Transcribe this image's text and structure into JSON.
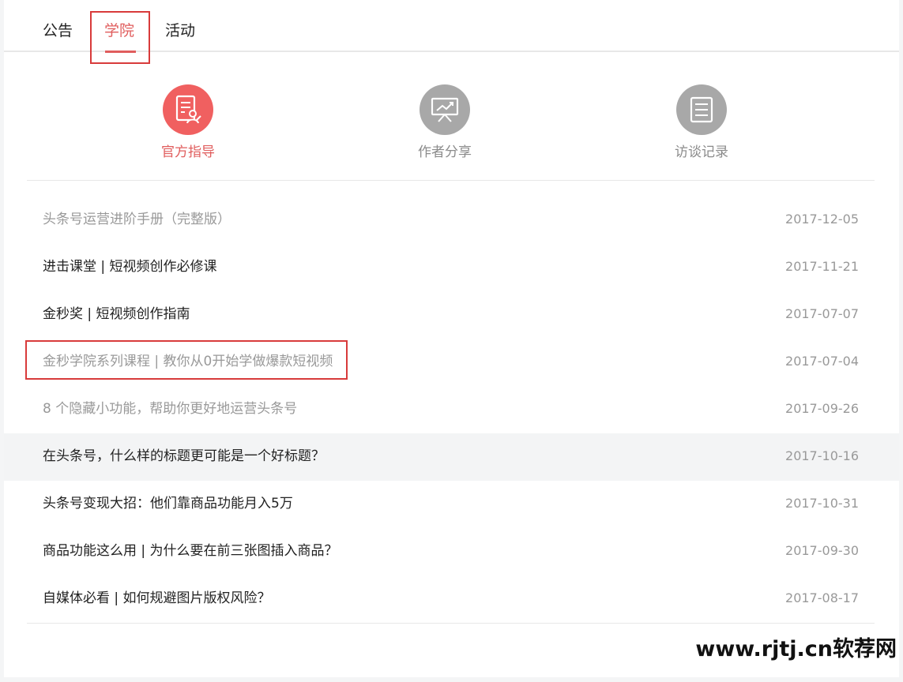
{
  "tabs": [
    {
      "label": "公告"
    },
    {
      "label": "学院"
    },
    {
      "label": "活动"
    }
  ],
  "categories": [
    {
      "label": "官方指导",
      "icon": "official-guide-icon"
    },
    {
      "label": "作者分享",
      "icon": "presentation-chart-icon"
    },
    {
      "label": "访谈记录",
      "icon": "interview-record-icon"
    }
  ],
  "articles": [
    {
      "title": "头条号运营进阶手册（完整版）",
      "date": "2017-12-05"
    },
    {
      "title": "进击课堂 | 短视频创作必修课",
      "date": "2017-11-21"
    },
    {
      "title": "金秒奖 | 短视频创作指南",
      "date": "2017-07-07"
    },
    {
      "title": "金秒学院系列课程 | 教你从0开始学做爆款短视频",
      "date": "2017-07-04"
    },
    {
      "title": "8 个隐藏小功能，帮助你更好地运营头条号",
      "date": "2017-09-26"
    },
    {
      "title": "在头条号，什么样的标题更可能是一个好标题？",
      "date": "2017-10-16"
    },
    {
      "title": "头条号变现大招：他们靠商品功能月入5万",
      "date": "2017-10-31"
    },
    {
      "title": "商品功能这么用 | 为什么要在前三张图插入商品？",
      "date": "2017-09-30"
    },
    {
      "title": "自媒体必看 | 如何规避图片版权风险？",
      "date": "2017-08-17"
    }
  ],
  "watermark": "www.rjtj.cn软荐网",
  "colors": {
    "accent": "#e05d5d",
    "highlight_box": "#d83b3b",
    "icon_gray": "#a8a8a8",
    "icon_red": "#f06060"
  }
}
